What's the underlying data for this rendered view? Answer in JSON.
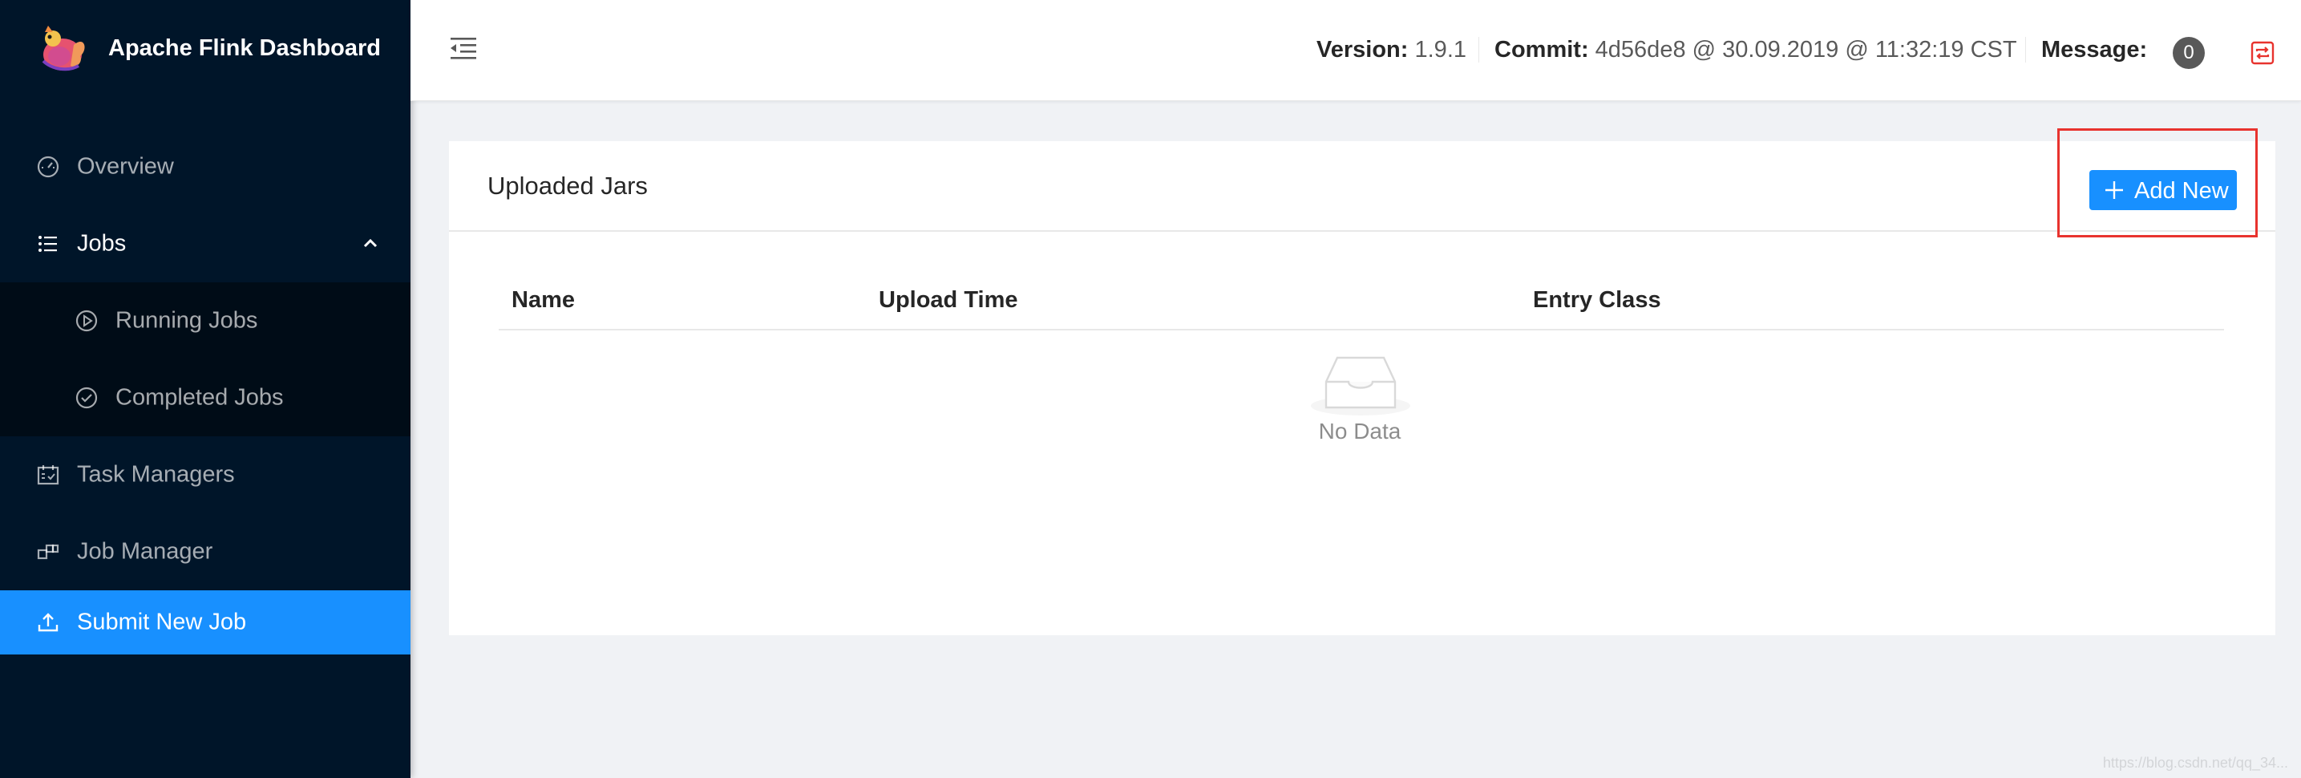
{
  "app": {
    "title": "Apache Flink Dashboard"
  },
  "sidebar": {
    "items": [
      {
        "label": "Overview",
        "icon": "dashboard-icon"
      },
      {
        "label": "Jobs",
        "icon": "unordered-list-icon",
        "expanded": true,
        "children": [
          {
            "label": "Running Jobs",
            "icon": "play-circle-icon"
          },
          {
            "label": "Completed Jobs",
            "icon": "check-circle-icon"
          }
        ]
      },
      {
        "label": "Task Managers",
        "icon": "schedule-icon"
      },
      {
        "label": "Job Manager",
        "icon": "build-icon"
      },
      {
        "label": "Submit New Job",
        "icon": "upload-icon",
        "selected": true
      }
    ]
  },
  "header": {
    "version_label": "Version:",
    "version_value": "1.9.1",
    "commit_label": "Commit:",
    "commit_value": "4d56de8 @ 30.09.2019 @ 11:32:19 CST",
    "message_label": "Message:",
    "message_count": "0"
  },
  "main": {
    "card_title": "Uploaded Jars",
    "add_button_label": "Add New",
    "table": {
      "columns": [
        "Name",
        "Upload Time",
        "Entry Class"
      ],
      "rows": [],
      "empty_text": "No Data"
    }
  },
  "colors": {
    "sidebar_bg": "#001529",
    "submenu_bg": "#000c17",
    "primary": "#1890ff",
    "highlight_box": "#e8332e",
    "content_bg": "#f0f2f5"
  },
  "watermark": "https://blog.csdn.net/qq_34..."
}
